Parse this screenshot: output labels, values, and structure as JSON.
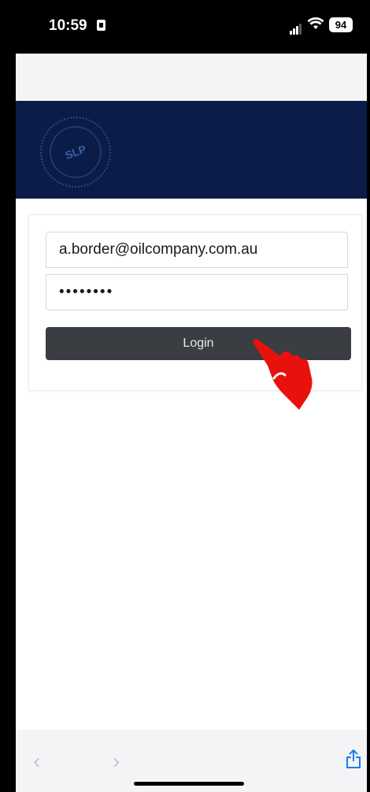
{
  "status_bar": {
    "time": "10:59",
    "battery": "94",
    "icons": [
      "sim-icon",
      "signal-icon",
      "wifi-icon",
      "battery-icon"
    ]
  },
  "banner": {
    "logo_text": "SLP",
    "background_color": "#0b1c48"
  },
  "login_form": {
    "email_value": "a.border@oilcompany.com.au",
    "password_value": "••••••••",
    "login_label": "Login",
    "button_color": "#3a3d42"
  },
  "bottom_toolbar": {
    "icons": [
      "back-icon",
      "forward-icon",
      "share-icon"
    ]
  }
}
